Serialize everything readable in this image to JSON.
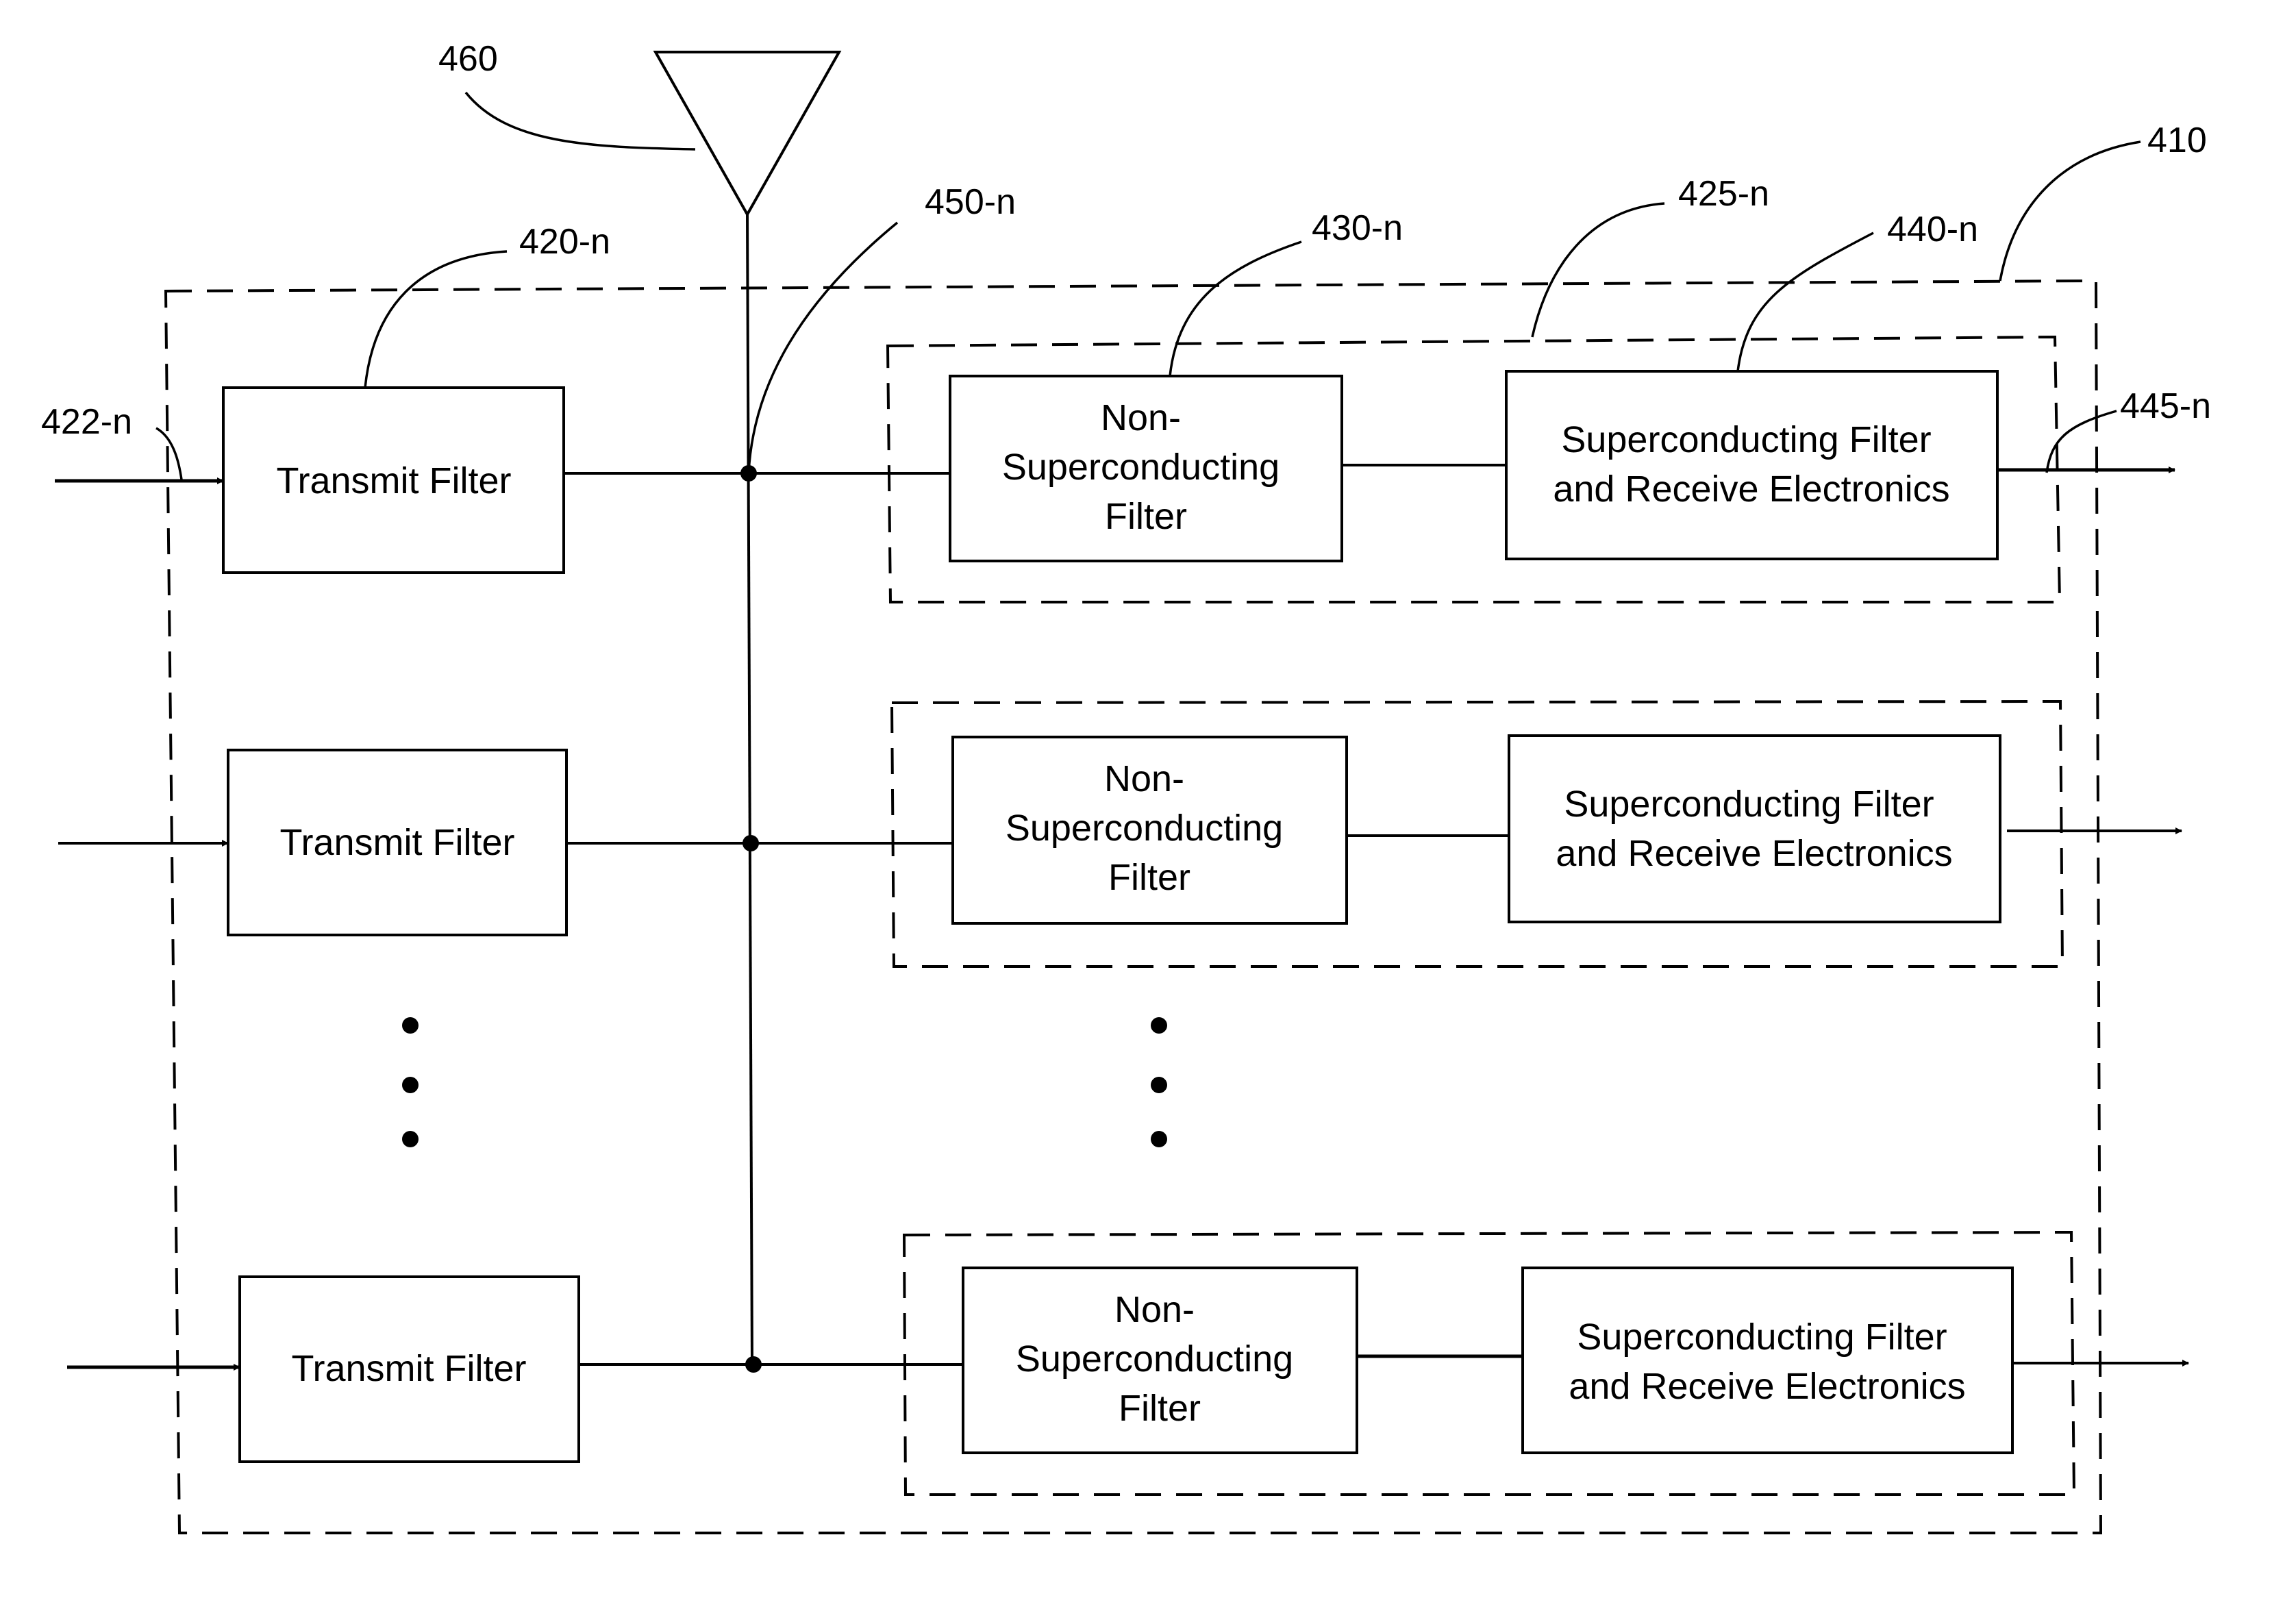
{
  "diagram": {
    "refs": {
      "antenna": "460",
      "transmit_filter": "420-n",
      "input": "422-n",
      "junction": "450-n",
      "non_superconducting_filter": "430-n",
      "receive_module": "425-n",
      "superconducting_block": "440-n",
      "output": "445-n",
      "system": "410"
    },
    "rows": [
      {
        "transmit_label": "Transmit Filter",
        "nsc_lines": [
          "Non-",
          "Superconducting",
          "Filter"
        ],
        "sc_lines": [
          "Superconducting Filter",
          "and Receive Electronics"
        ]
      },
      {
        "transmit_label": "Transmit Filter",
        "nsc_lines": [
          "Non-",
          "Superconducting",
          "Filter"
        ],
        "sc_lines": [
          "Superconducting Filter",
          "and Receive Electronics"
        ]
      },
      {
        "transmit_label": "Transmit Filter",
        "nsc_lines": [
          "Non-",
          "Superconducting",
          "Filter"
        ],
        "sc_lines": [
          "Superconducting Filter",
          "and Receive Electronics"
        ]
      }
    ],
    "ellipsis": "⋮"
  }
}
